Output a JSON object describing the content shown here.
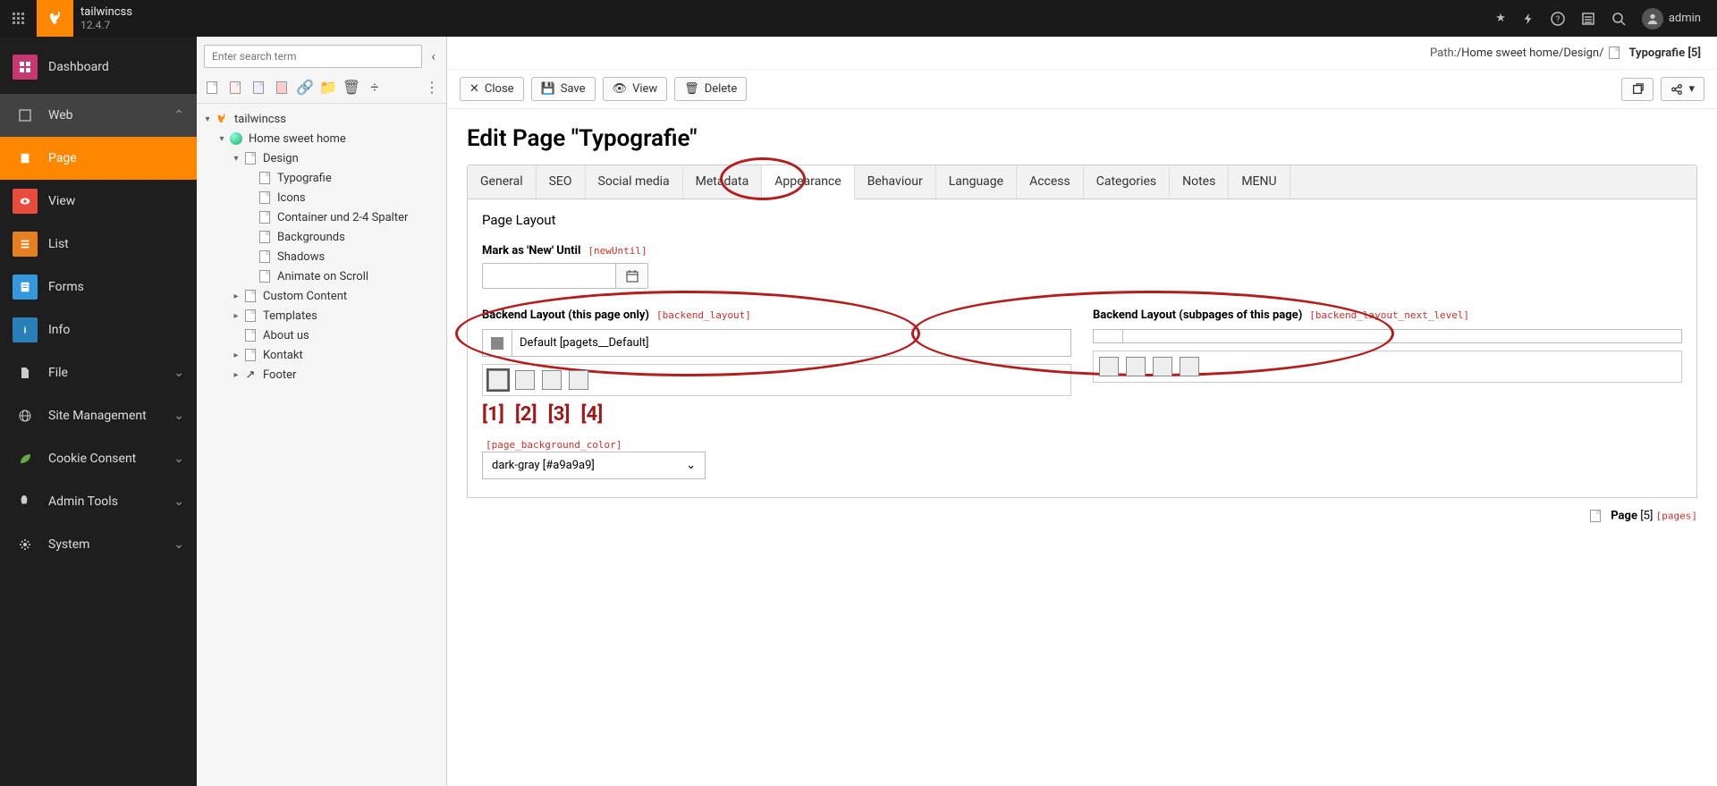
{
  "topbar": {
    "brand": "tailwincss",
    "version": "12.4.7",
    "user": "admin"
  },
  "sidebar": {
    "dashboard": "Dashboard",
    "groups": [
      {
        "label": "Web",
        "items": [
          "Page",
          "View",
          "List",
          "Forms",
          "Info"
        ],
        "active": 0
      },
      {
        "label": "File"
      },
      {
        "label": "Site Management"
      },
      {
        "label": "Cookie Consent"
      },
      {
        "label": "Admin Tools"
      },
      {
        "label": "System"
      }
    ]
  },
  "tree": {
    "search_placeholder": "Enter search term",
    "root": "tailwincss",
    "nodes": [
      {
        "label": "Home sweet home",
        "depth": 1,
        "expanded": true,
        "icon": "globe"
      },
      {
        "label": "Design",
        "depth": 2,
        "expanded": true,
        "icon": "page-folder"
      },
      {
        "label": "Typografie",
        "depth": 3,
        "icon": "page"
      },
      {
        "label": "Icons",
        "depth": 3,
        "icon": "page"
      },
      {
        "label": "Container und 2-4 Spalter",
        "depth": 3,
        "icon": "page"
      },
      {
        "label": "Backgrounds",
        "depth": 3,
        "icon": "page"
      },
      {
        "label": "Shadows",
        "depth": 3,
        "icon": "page"
      },
      {
        "label": "Animate on Scroll",
        "depth": 3,
        "icon": "page"
      },
      {
        "label": "Custom Content",
        "depth": 2,
        "expanded": false,
        "icon": "page-folder",
        "has_children": true
      },
      {
        "label": "Templates",
        "depth": 2,
        "expanded": false,
        "icon": "page-folder",
        "has_children": true
      },
      {
        "label": "About us",
        "depth": 2,
        "icon": "page"
      },
      {
        "label": "Kontakt",
        "depth": 2,
        "icon": "page",
        "has_children": true
      },
      {
        "label": "Footer",
        "depth": 2,
        "icon": "link",
        "has_children": true
      }
    ]
  },
  "main": {
    "path_label": "Path: ",
    "path": "/Home sweet home/Design/",
    "crumb_title": "Typografie [5]",
    "actions": {
      "close": "Close",
      "save": "Save",
      "view": "View",
      "delete": "Delete"
    },
    "title": "Edit Page \"Typografie\"",
    "tabs": [
      "General",
      "SEO",
      "Social media",
      "Metadata",
      "Appearance",
      "Behaviour",
      "Language",
      "Access",
      "Categories",
      "Notes",
      "MENU"
    ],
    "active_tab": 4,
    "panel": {
      "section": "Page Layout",
      "newuntil_label": "Mark as 'New' Until",
      "newuntil_key": "[newUntil]",
      "backend_layout_label": "Backend Layout (this page only)",
      "backend_layout_key": "[backend_layout]",
      "backend_layout_value": "Default [pagets__Default]",
      "backend_layout_sub_label": "Backend Layout (subpages of this page)",
      "backend_layout_sub_key": "[backend_layout_next_level]",
      "backend_layout_sub_value": "",
      "annot_numbers": [
        "[1]",
        "[2]",
        "[3]",
        "[4]"
      ],
      "bg_color_key": "[page_background_color]",
      "bg_color_value": "dark-gray [#a9a9a9]"
    },
    "footer": {
      "page_label": "Page",
      "page_id": "[5]",
      "key": "[pages]"
    }
  }
}
